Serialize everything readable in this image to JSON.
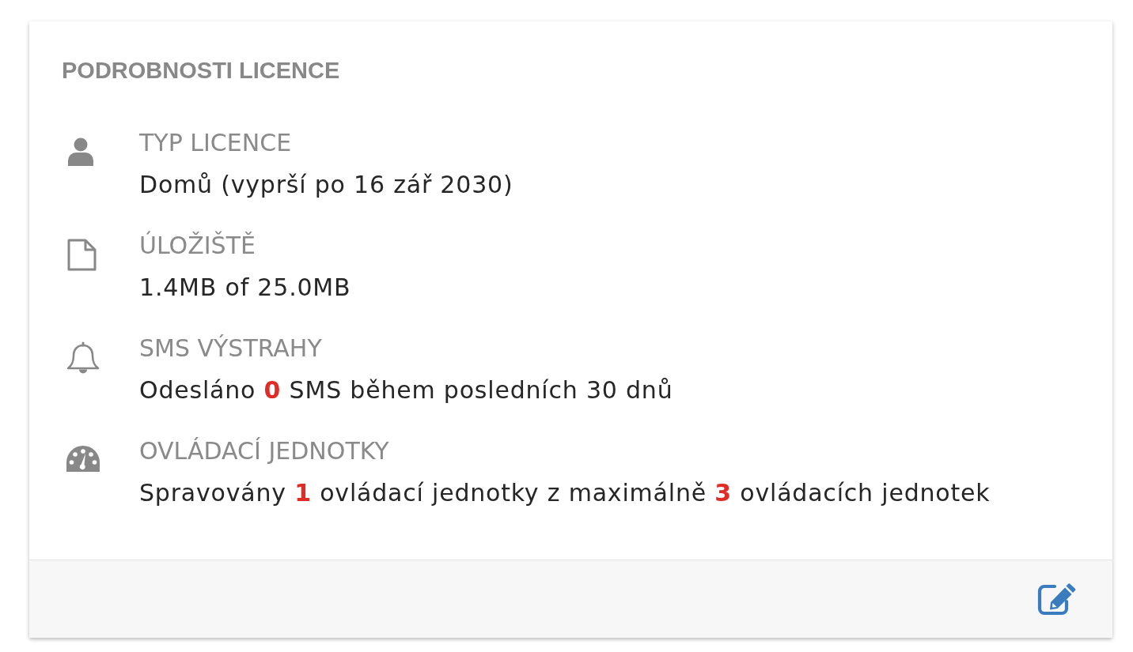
{
  "panel": {
    "title": "PODROBNOSTI LICENCE",
    "items": [
      {
        "label": "TYP LICENCE",
        "value": "Domů (vyprší po 16 zář 2030)"
      },
      {
        "label": "ÚLOŽIŠTĚ",
        "value": "1.4MB of 25.0MB"
      },
      {
        "label": "SMS VÝSTRAHY",
        "value": "Odesláno **0** SMS během posledních 30 dnů"
      },
      {
        "label": "OVLÁDACÍ JEDNOTKY",
        "value": "Spravovány **1** ovládací jednotky z maximálně **3** ovládacích jednotek"
      }
    ]
  }
}
